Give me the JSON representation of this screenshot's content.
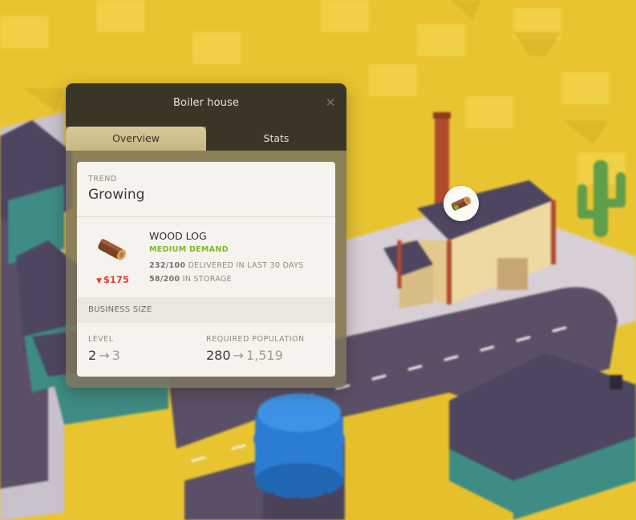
{
  "panel": {
    "title": "Boiler house",
    "close_icon": "close-icon",
    "tabs": [
      {
        "label": "Overview",
        "active": true
      },
      {
        "label": "Stats",
        "active": false
      }
    ]
  },
  "trend": {
    "label": "TREND",
    "value": "Growing"
  },
  "resource": {
    "icon": "wood-log-icon",
    "name": "WOOD LOG",
    "demand": "MEDIUM DEMAND",
    "price_change_icon": "down-triangle",
    "price": "$175",
    "delivered_amount": "232/100",
    "delivered_text": "DELIVERED IN LAST 30 DAYS",
    "storage_amount": "58/200",
    "storage_text": "IN STORAGE"
  },
  "business_size": {
    "label": "BUSINESS SIZE",
    "level_label": "LEVEL",
    "level_current": "2",
    "level_next": "3",
    "population_label": "REQUIRED POPULATION",
    "population_current": "280",
    "population_next": "1,519",
    "arrow": "→"
  },
  "scene": {
    "bubble_icon": "wood-log-icon",
    "colors": {
      "ground": "#e9c431",
      "road": "#5a4f66",
      "roof": "#4e4561",
      "wall_teal": "#3e8c84",
      "factory_wall": "#eed9a3",
      "factory_trim": "#b04a2c",
      "tower": "#2b7cd3",
      "cactus": "#5f9e4a"
    }
  }
}
